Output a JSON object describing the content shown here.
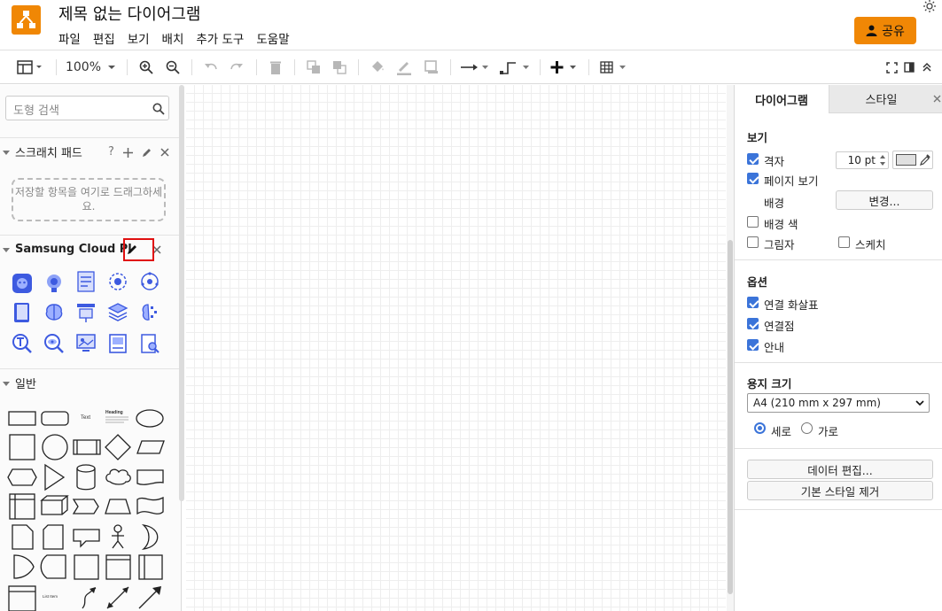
{
  "header": {
    "title": "제목 없는 다이어그램",
    "menu": [
      "파일",
      "편집",
      "보기",
      "배치",
      "추가 도구",
      "도움말"
    ],
    "share_label": "공유"
  },
  "toolbar": {
    "zoom": "100%"
  },
  "left": {
    "search_placeholder": "도형 검색",
    "scratchpad_title": "스크래치 패드",
    "scratchpad_help": "?",
    "scratchpad_drop_text": "저장할 항목을 여기로 드래그하세요.",
    "library_title": "Samsung Cloud Pl",
    "general_title": "일반",
    "text_shape_label": "Text",
    "heading_shape_label": "Heading",
    "list_shape_label": "List Item"
  },
  "right": {
    "tabs": [
      "다이어그램",
      "스타일"
    ],
    "view_section": "보기",
    "grid_label": "격자",
    "grid_size": "10 pt",
    "page_view_label": "페이지 보기",
    "background_label": "배경",
    "change_button": "변경...",
    "background_color_label": "배경 색",
    "shadow_label": "그림자",
    "sketch_label": "스케치",
    "options_section": "옵션",
    "connection_arrows_label": "연결 화살표",
    "connection_points_label": "연결점",
    "guides_label": "안내",
    "paper_size_section": "용지 크기",
    "paper_size_value": "A4 (210 mm x 297 mm)",
    "portrait_label": "세로",
    "landscape_label": "가로",
    "edit_data_button": "데이터 편집...",
    "clear_style_button": "기본 스타일 제거"
  },
  "colors": {
    "accent": "#f08705",
    "check": "#3b74d9",
    "highlight": "#e01010"
  }
}
